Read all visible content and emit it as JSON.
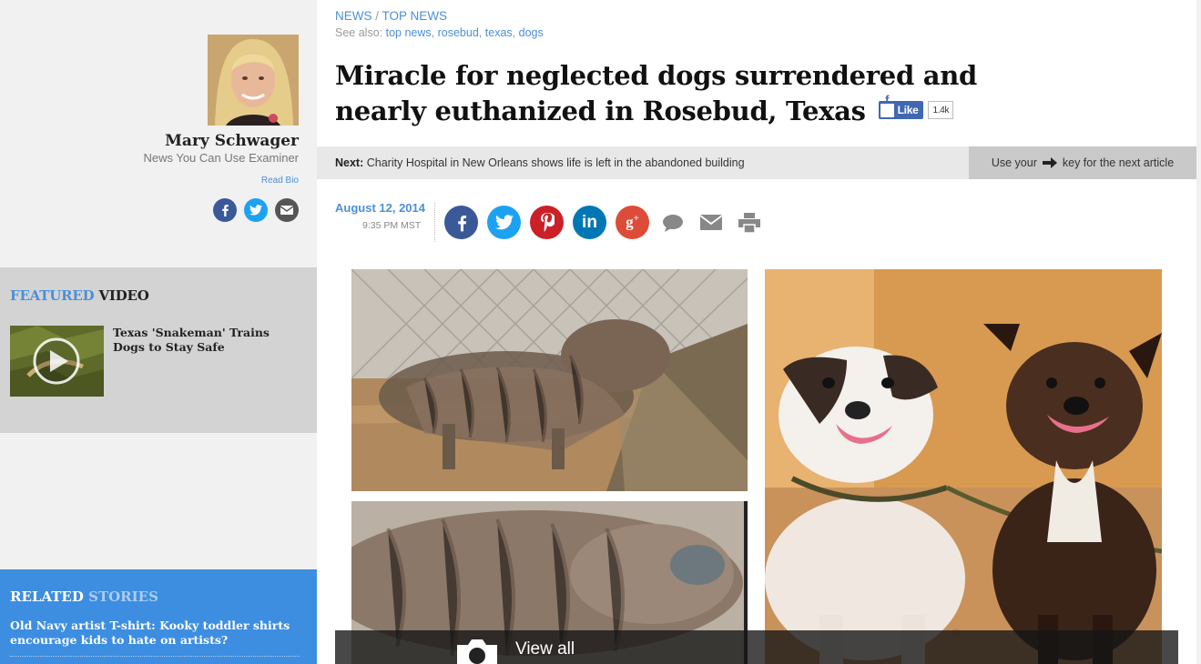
{
  "author": {
    "name": "Mary Schwager",
    "title": "News You Can Use Examiner",
    "read_bio": "Read Bio",
    "social_icons": [
      "facebook-icon",
      "twitter-icon",
      "email-icon"
    ]
  },
  "featured_video": {
    "heading_accent": "FEATURED",
    "heading_rest": "VIDEO",
    "title": "Texas 'Snakeman' Trains Dogs to Stay Safe"
  },
  "related_stories": {
    "heading_main": "RELATED",
    "heading_accent": "STORIES",
    "items": [
      "Old Navy artist T-shirt: Kooky toddler shirts encourage kids to hate on artists?"
    ]
  },
  "breadcrumb": {
    "section": "NEWS",
    "separator": "/",
    "subsection": "TOP NEWS"
  },
  "see_also": {
    "label": "See also:",
    "links": [
      "top news",
      "rosebud",
      "texas",
      "dogs"
    ]
  },
  "article": {
    "headline": "Miracle for neglected dogs surrendered and nearly euthanized in Rosebud, Texas",
    "fb_like_label": "Like",
    "fb_like_count": "1.4k",
    "date": "August 12, 2014",
    "time": "9:35 PM MST"
  },
  "next_bar": {
    "label": "Next:",
    "next_title": "Charity Hospital in New Orleans shows life is left in the abandoned building",
    "key_hint_before": "Use your",
    "key_hint_after": "key for the next article"
  },
  "share_icons": [
    "facebook-icon",
    "twitter-icon",
    "pinterest-icon",
    "linkedin-icon",
    "google-plus-icon",
    "comment-icon",
    "email-icon",
    "print-icon"
  ],
  "gallery": {
    "view_all_label": "View all"
  },
  "colors": {
    "accent_blue": "#4a90d9",
    "related_bg": "#3d8ee0",
    "facebook": "#3b5998",
    "twitter": "#1da1f2",
    "pinterest": "#cb2027",
    "linkedin": "#0077b5",
    "google_plus": "#dd4b39"
  }
}
